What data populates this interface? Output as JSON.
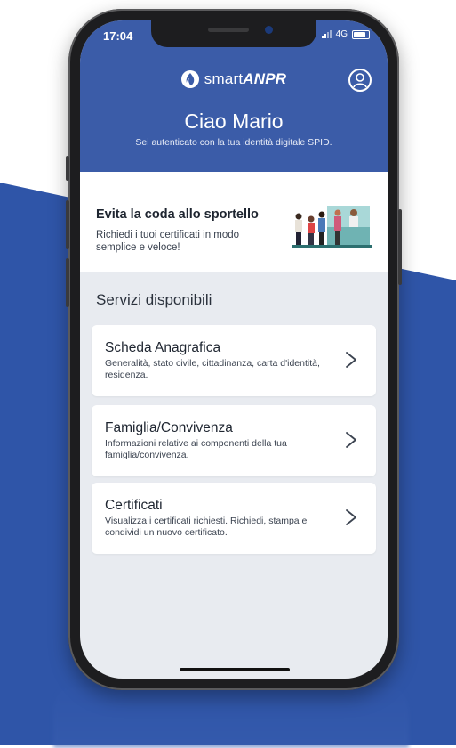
{
  "colors": {
    "brand_blue": "#3b5ca8",
    "background_blue": "#2f55a8",
    "screen_bg": "#e8ebf0",
    "card_bg": "#ffffff"
  },
  "status_bar": {
    "time": "17:04",
    "network": "4G",
    "signal_icon": "signal-bars-icon",
    "battery_icon": "battery-icon"
  },
  "header": {
    "logo_icon": "anpr-flame-logo-icon",
    "logo_prefix": "smart",
    "logo_brand": "ANPR",
    "profile_icon": "user-profile-icon",
    "greeting": "Ciao Mario",
    "subtitle": "Sei autenticato con la tua identità digitale SPID."
  },
  "promo": {
    "title": "Evita la coda allo sportello",
    "description": "Richiedi i tuoi certificati in modo semplice e veloce!",
    "illustration": "queue-at-counter-illustration"
  },
  "services": {
    "section_title": "Servizi disponibili",
    "items": [
      {
        "title": "Scheda Anagrafica",
        "description": "Generalità, stato civile, cittadinanza, carta d'identità, residenza.",
        "icon": "chevron-right-icon"
      },
      {
        "title": "Famiglia/Convivenza",
        "description": "Informazioni relative ai componenti della tua famiglia/convivenza.",
        "icon": "chevron-right-icon"
      },
      {
        "title": "Certificati",
        "description": "Visualizza i certificati richiesti. Richiedi, stampa e condividi un nuovo certificato.",
        "icon": "chevron-right-icon"
      }
    ]
  }
}
